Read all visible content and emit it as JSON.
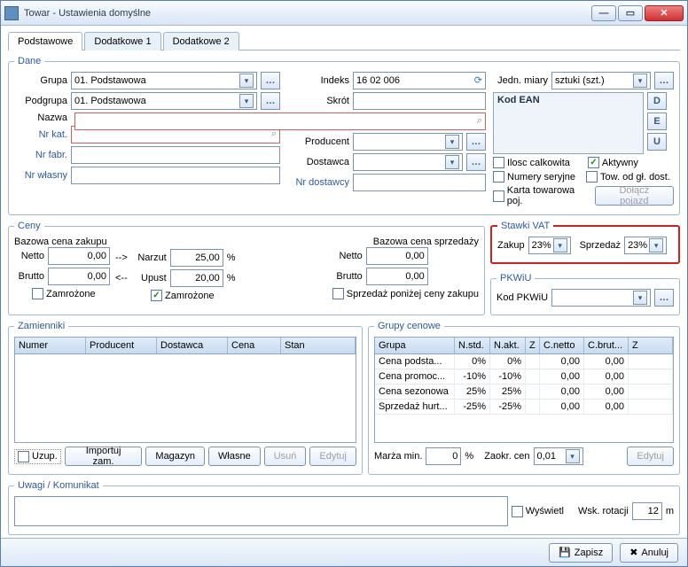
{
  "window": {
    "title": "Towar - Ustawienia domyślne"
  },
  "tabs": {
    "t0": "Podstawowe",
    "t1": "Dodatkowe 1",
    "t2": "Dodatkowe 2"
  },
  "dane": {
    "legend": "Dane",
    "grupa_label": "Grupa",
    "grupa_value": "01. Podstawowa",
    "podgrupa_label": "Podgrupa",
    "podgrupa_value": "01. Podstawowa",
    "nazwa_label": "Nazwa",
    "nazwa_value": "",
    "nrkat_label": "Nr kat.",
    "nrkat_value": "",
    "nrfabr_label": "Nr fabr.",
    "nrfabr_value": "",
    "nrwlasny_label": "Nr własny",
    "nrwlasny_value": "",
    "indeks_label": "Indeks",
    "indeks_value": "16 02 006",
    "skrot_label": "Skrót",
    "skrot_value": "",
    "producent_label": "Producent",
    "producent_value": "",
    "dostawca_label": "Dostawca",
    "dostawca_value": "",
    "nrdostawcy_label": "Nr dostawcy",
    "nrdostawcy_value": "",
    "jedn_label": "Jedn. miary",
    "jedn_value": "sztuki (szt.)",
    "kodean_label": "Kod EAN",
    "chk_ilosc": "Ilosc calkowita",
    "chk_aktywny": "Aktywny",
    "chk_numery": "Numery seryjne",
    "chk_towod": "Tow. od gł. dost.",
    "chk_karta": "Karta towarowa poj.",
    "btn_dolacz": "Dołącz pojazd",
    "btn_d": "D",
    "btn_e": "E",
    "btn_u": "U"
  },
  "ceny": {
    "legend": "Ceny",
    "bazowa_zakupu": "Bazowa cena zakupu",
    "bazowa_sprzedazy": "Bazowa cena sprzedaży",
    "netto": "Netto",
    "brutto": "Brutto",
    "narzut": "Narzut",
    "upust": "Upust",
    "netto_zak": "0,00",
    "brutto_zak": "0,00",
    "narzut_val": "25,00",
    "upust_val": "20,00",
    "netto_spr": "0,00",
    "brutto_spr": "0,00",
    "zamrozone": "Zamrożone",
    "sprz_ponizej": "Sprzedaż poniżej ceny zakupu",
    "arrow_r": "-->",
    "arrow_l": "<--",
    "pct": "%"
  },
  "vat": {
    "legend": "Stawki VAT",
    "zakup_label": "Zakup",
    "zakup_val": "23%",
    "sprzedaz_label": "Sprzedaż",
    "sprzedaz_val": "23%"
  },
  "pkwiu": {
    "legend": "PKWiU",
    "label": "Kod PKWiU",
    "value": ""
  },
  "zamienniki": {
    "legend": "Zamienniki",
    "cols": {
      "c0": "Numer",
      "c1": "Producent",
      "c2": "Dostawca",
      "c3": "Cena",
      "c4": "Stan"
    },
    "chk_uzup": "Uzup.",
    "btn_import": "Importuj zam.",
    "btn_magazyn": "Magazyn",
    "btn_wlasne": "Własne",
    "btn_usun": "Usuń",
    "btn_edytuj": "Edytuj"
  },
  "grupycen": {
    "legend": "Grupy cenowe",
    "cols": {
      "c0": "Grupa",
      "c1": "N.std.",
      "c2": "N.akt.",
      "c3": "Z",
      "c4": "C.netto",
      "c5": "C.brut...",
      "c6": "Z"
    },
    "rows": [
      {
        "g": "Cena podsta...",
        "nstd": "0%",
        "nakt": "0%",
        "z1": "",
        "cn": "0,00",
        "cb": "0,00",
        "z2": ""
      },
      {
        "g": "Cena promoc...",
        "nstd": "-10%",
        "nakt": "-10%",
        "z1": "",
        "cn": "0,00",
        "cb": "0,00",
        "z2": ""
      },
      {
        "g": "Cena sezonowa",
        "nstd": "25%",
        "nakt": "25%",
        "z1": "",
        "cn": "0,00",
        "cb": "0,00",
        "z2": ""
      },
      {
        "g": "Sprzedaż hurt...",
        "nstd": "-25%",
        "nakt": "-25%",
        "z1": "",
        "cn": "0,00",
        "cb": "0,00",
        "z2": ""
      }
    ],
    "marza_label": "Marża min.",
    "marza_val": "0",
    "marza_pct": "%",
    "zaokr_label": "Zaokr. cen",
    "zaokr_val": "0,01",
    "btn_edytuj": "Edytuj"
  },
  "uwagi": {
    "legend": "Uwagi / Komunikat",
    "value": "",
    "wyswietl": "Wyświetl",
    "wsk_label": "Wsk. rotacji",
    "wsk_val": "12",
    "wsk_unit": "m"
  },
  "footer": {
    "zapisz": "Zapisz",
    "anuluj": "Anuluj"
  }
}
